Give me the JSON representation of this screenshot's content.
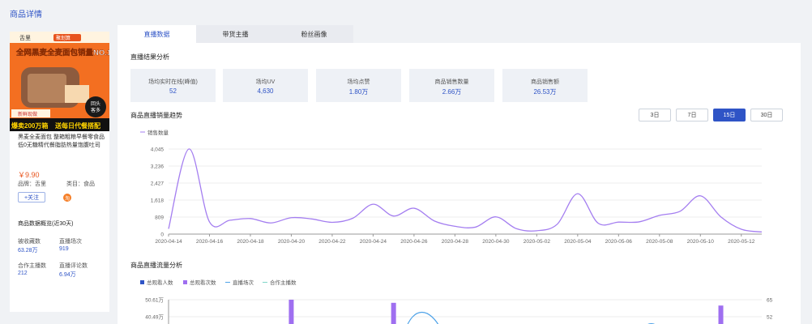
{
  "page_title": "商品详情",
  "product": {
    "banner": {
      "brand": "舌里",
      "brand_tag": "聚划算",
      "headline": "全网黑麦全麦面包销量NO.1",
      "badge_top": "回头",
      "badge_bottom": "客多",
      "tag_fresh": "新鲜现做",
      "promo_left": "爆卖200万箱",
      "promo_right": "送每日代餐搭配"
    },
    "name": "黑麦全麦面包 整箱粗粮早餐零食品低0无糖精代餐脂肪热量饱腹吐司",
    "price": "￥9.90",
    "brand_label": "品牌：舌里",
    "category_label": "类目：食品",
    "follow_label": "+关注",
    "platform_icon_text": "淘",
    "overview_title": "商品数据概览(近30天)",
    "stats": [
      {
        "label": "被收藏数",
        "value": "63.28万"
      },
      {
        "label": "直播场次",
        "value": "919"
      },
      {
        "label": "合作主播数",
        "value": "212"
      },
      {
        "label": "直播评论数",
        "value": "6.94万"
      }
    ]
  },
  "tabs": [
    {
      "label": "直播数据",
      "active": true
    },
    {
      "label": "带货主播",
      "active": false
    },
    {
      "label": "粉丝画像",
      "active": false
    }
  ],
  "live_results": {
    "title": "直播结果分析",
    "kpis": [
      {
        "label": "场均实时在线(峰值)",
        "value": "52"
      },
      {
        "label": "场均UV",
        "value": "4,630"
      },
      {
        "label": "场均点赞",
        "value": "1.80万"
      },
      {
        "label": "商品销售数量",
        "value": "2.66万"
      },
      {
        "label": "商品销售额",
        "value": "26.53万"
      }
    ]
  },
  "sales_trend": {
    "title": "商品直播销量趋势",
    "ranges": [
      {
        "label": "3日",
        "active": false
      },
      {
        "label": "7日",
        "active": false
      },
      {
        "label": "15日",
        "active": true
      },
      {
        "label": "30日",
        "active": false
      }
    ]
  },
  "traffic": {
    "title": "商品直播流量分析",
    "legend": [
      "总观看人数",
      "总观看次数",
      "直播场次",
      "合作主播数"
    ],
    "left_ticks": [
      "50.61万",
      "40.49万"
    ],
    "right_ticks": [
      "65",
      "52"
    ]
  },
  "colors": {
    "accent": "#2f54c6",
    "line": "#a47ef0",
    "price": "#e8541d",
    "bar": "#9f6ff0",
    "line_blue": "#4fa3e8",
    "line_teal": "#7fd6c8"
  },
  "chart_data": {
    "type": "line",
    "title": "",
    "xlabel": "",
    "ylabel": "",
    "legend": "top-left",
    "grid": true,
    "ylim": [
      0,
      4045
    ],
    "yticks": [
      "0",
      "809",
      "1,618",
      "2,427",
      "3,236",
      "4,045"
    ],
    "xticks": [
      "2020-04-14",
      "2020-04-16",
      "2020-04-18",
      "2020-04-20",
      "2020-04-22",
      "2020-04-24",
      "2020-04-26",
      "2020-04-28",
      "2020-04-30",
      "2020-05-02",
      "2020-05-04",
      "2020-05-06",
      "2020-05-08",
      "2020-05-10",
      "2020-05-12"
    ],
    "series": [
      {
        "name": "销售数量",
        "x": [
          "2020-04-14",
          "2020-04-15",
          "2020-04-16",
          "2020-04-17",
          "2020-04-18",
          "2020-04-19",
          "2020-04-20",
          "2020-04-21",
          "2020-04-22",
          "2020-04-23",
          "2020-04-24",
          "2020-04-25",
          "2020-04-26",
          "2020-04-27",
          "2020-04-28",
          "2020-04-29",
          "2020-04-30",
          "2020-05-01",
          "2020-05-02",
          "2020-05-03",
          "2020-05-04",
          "2020-05-05",
          "2020-05-06",
          "2020-05-07",
          "2020-05-08",
          "2020-05-09",
          "2020-05-10",
          "2020-05-11",
          "2020-05-12",
          "2020-05-13"
        ],
        "values": [
          250,
          4050,
          580,
          660,
          740,
          530,
          780,
          720,
          560,
          750,
          1420,
          860,
          1230,
          620,
          370,
          330,
          820,
          260,
          160,
          470,
          1920,
          520,
          570,
          580,
          890,
          1080,
          1820,
          820,
          230,
          100
        ]
      }
    ]
  },
  "traffic_chart_data": {
    "type": "bar",
    "title": "",
    "legend": "top-left",
    "left_ylim": [
      0,
      50.61
    ],
    "right_ylim": [
      0,
      65
    ],
    "series": [
      {
        "name": "总观看人数",
        "values": []
      },
      {
        "name": "总观看次数",
        "values": [
          {
            "x": "2020-04-20",
            "value": 50.61
          },
          {
            "x": "2020-04-25",
            "value": 45.5
          },
          {
            "x": "2020-05-11",
            "value": 41
          }
        ]
      },
      {
        "name": "直播场次",
        "values": []
      },
      {
        "name": "合作主播数",
        "values": []
      }
    ]
  }
}
